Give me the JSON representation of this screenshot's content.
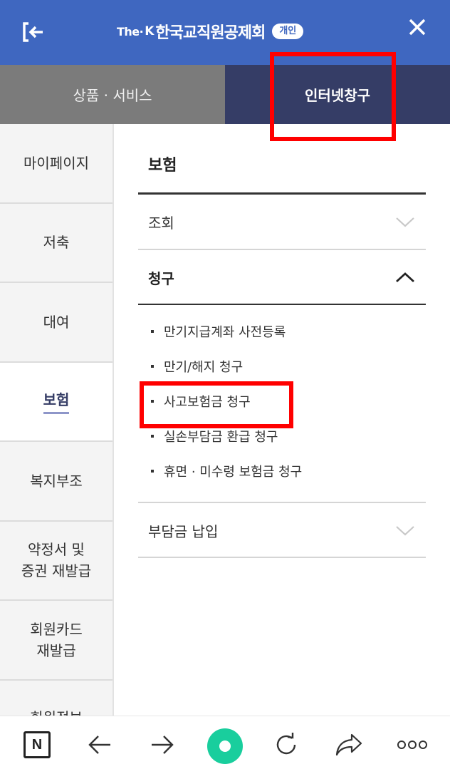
{
  "header": {
    "logo_the": "The·",
    "logo_k": "K",
    "logo_name": "한국교직원공제회",
    "logo_badge": "개인"
  },
  "tabs": [
    {
      "label": "상품 · 서비스"
    },
    {
      "label": "인터넷창구"
    }
  ],
  "sidebar": {
    "items": [
      {
        "label": "마이페이지"
      },
      {
        "label": "저축"
      },
      {
        "label": "대여"
      },
      {
        "label": "보험"
      },
      {
        "label": "복지부조"
      },
      {
        "label_line1": "약정서 및",
        "label_line2": "증권 재발급"
      },
      {
        "label_line1": "회원카드",
        "label_line2": "재발급"
      },
      {
        "label": "회원정보"
      }
    ]
  },
  "main": {
    "title": "보험",
    "accordion": [
      {
        "label": "조회",
        "expanded": false
      },
      {
        "label": "청구",
        "expanded": true
      },
      {
        "label": "부담금 납입",
        "expanded": false
      }
    ],
    "claim_items": [
      {
        "label": "만기지급계좌 사전등록"
      },
      {
        "label": "만기/해지 청구"
      },
      {
        "label": "사고보험금 청구"
      },
      {
        "label": "실손부담금 환급 청구"
      },
      {
        "label": "휴면 · 미수령 보험금 청구"
      }
    ]
  },
  "bottombar": {
    "n_label": "N"
  },
  "colors": {
    "header_bg": "#3f67c0",
    "tab_active_bg": "#353d66",
    "tab_inactive_bg": "#7b7b7b",
    "highlight": "#ff0000",
    "naver_green": "#19ce9d"
  },
  "icons": [
    "logout-icon",
    "close-icon",
    "chevron-down-icon",
    "chevron-up-icon",
    "naver-n-icon",
    "back-arrow-icon",
    "forward-arrow-icon",
    "home-dot-icon",
    "refresh-icon",
    "share-icon",
    "more-icon"
  ]
}
